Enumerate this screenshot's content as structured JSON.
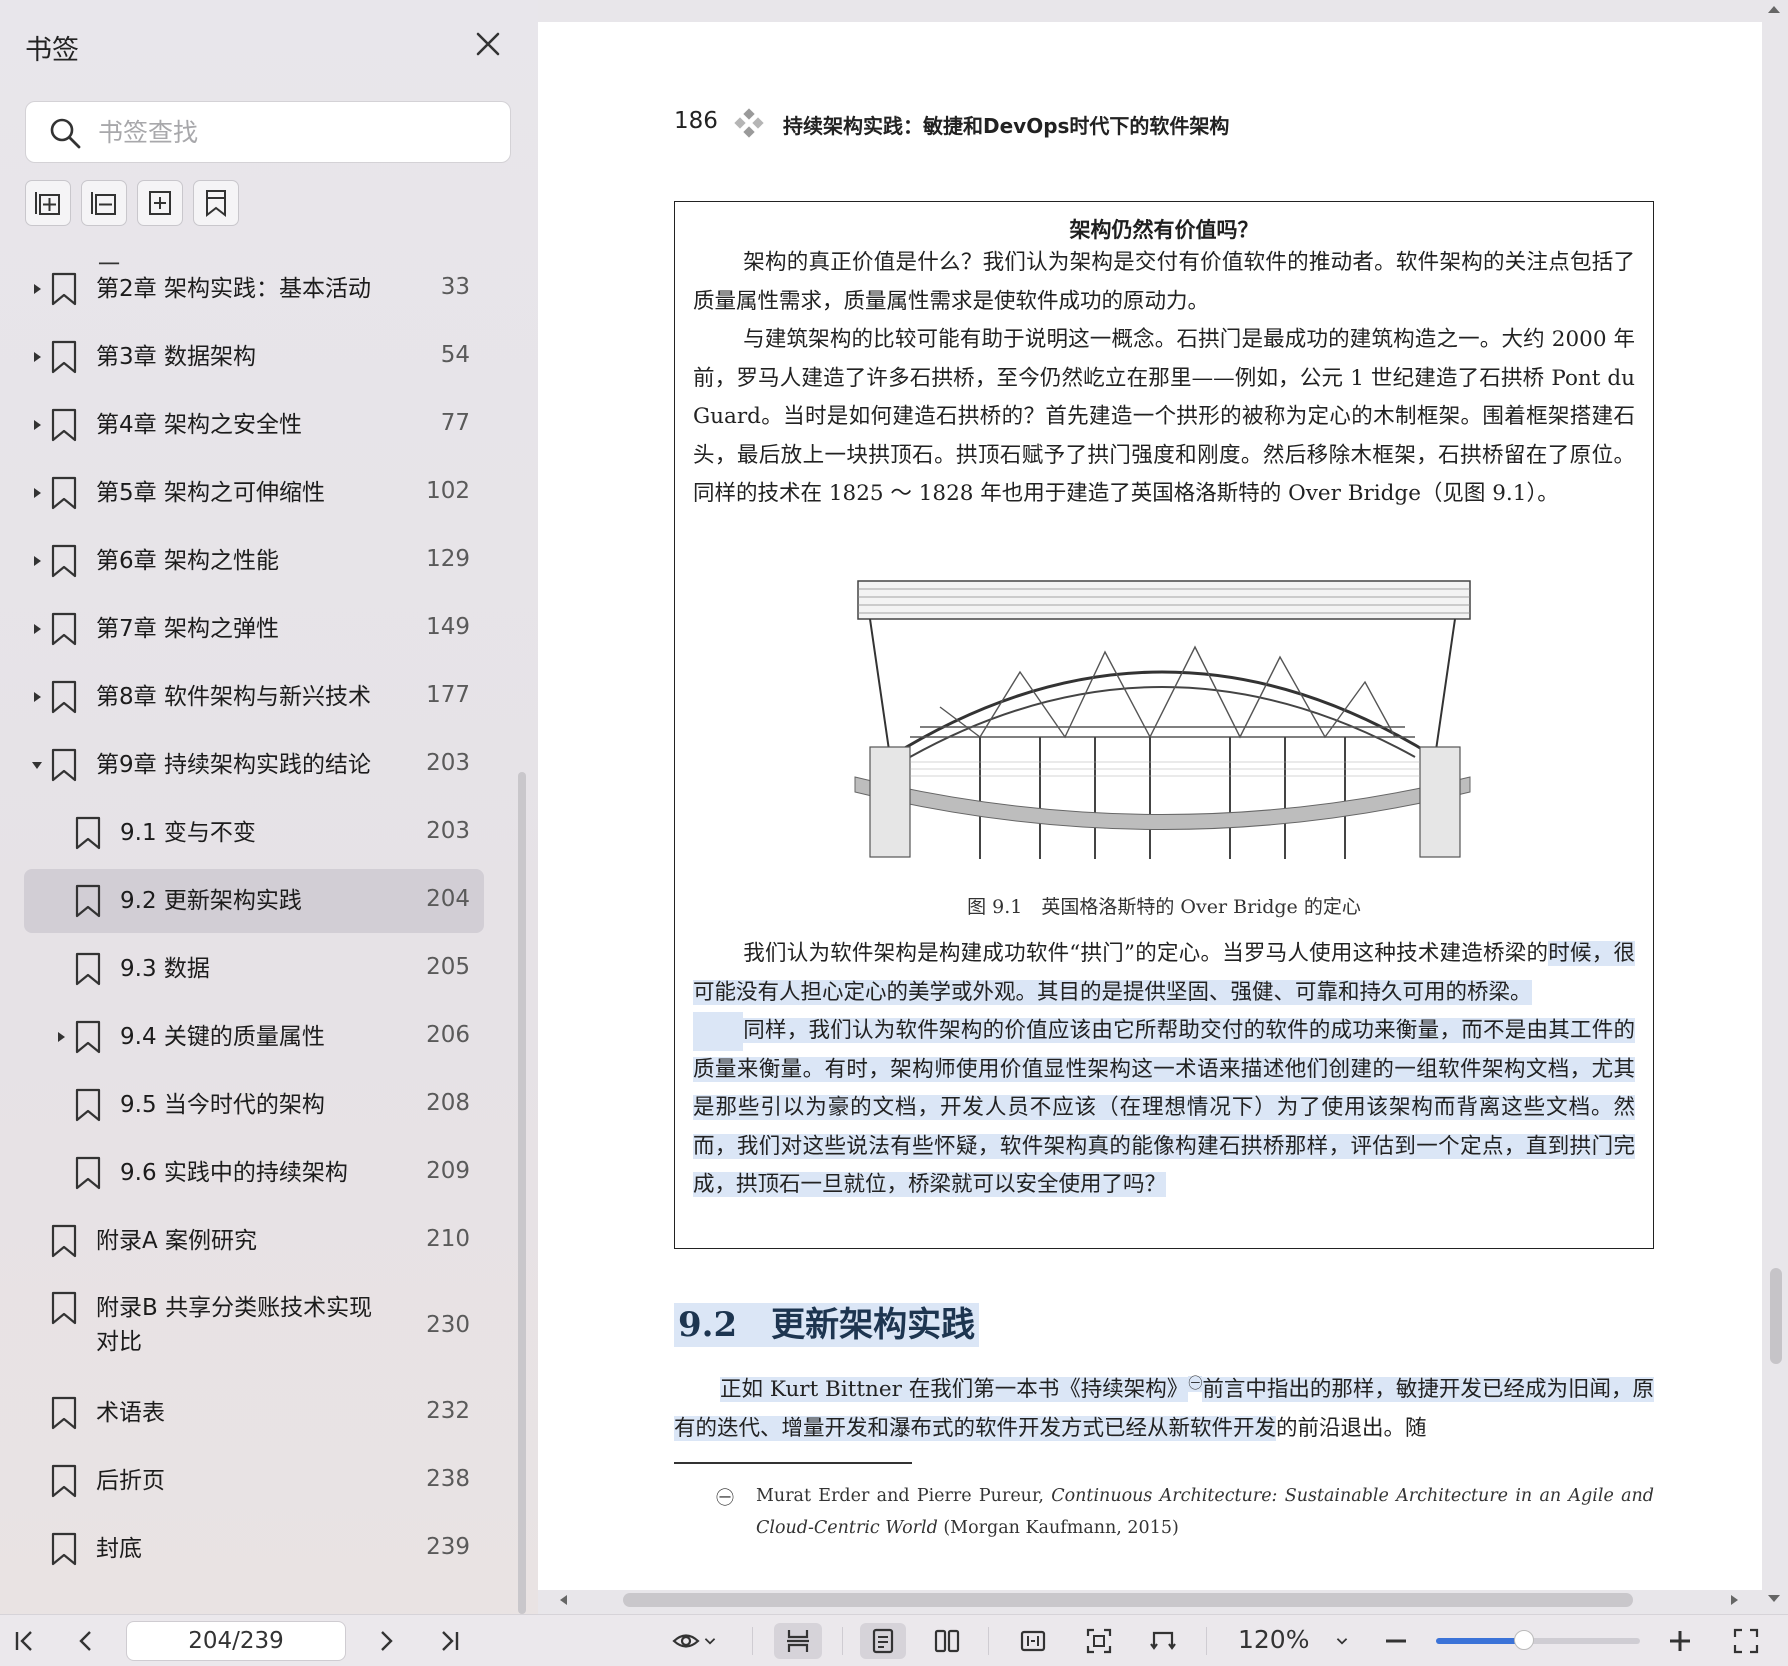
{
  "sidebar": {
    "title": "书签",
    "search_placeholder": "书签查找",
    "stray_mark": "一",
    "items": [
      {
        "label": "第2章 架构实践：基本活动",
        "page": "33",
        "level": 0,
        "caret": "right"
      },
      {
        "label": "第3章 数据架构",
        "page": "54",
        "level": 0,
        "caret": "right"
      },
      {
        "label": "第4章 架构之安全性",
        "page": "77",
        "level": 0,
        "caret": "right"
      },
      {
        "label": "第5章 架构之可伸缩性",
        "page": "102",
        "level": 0,
        "caret": "right"
      },
      {
        "label": "第6章 架构之性能",
        "page": "129",
        "level": 0,
        "caret": "right"
      },
      {
        "label": "第7章 架构之弹性",
        "page": "149",
        "level": 0,
        "caret": "right"
      },
      {
        "label": "第8章 软件架构与新兴技术",
        "page": "177",
        "level": 0,
        "caret": "right"
      },
      {
        "label": "第9章 持续架构实践的结论",
        "page": "203",
        "level": 0,
        "caret": "down"
      },
      {
        "label": "9.1 变与不变",
        "page": "203",
        "level": 1,
        "caret": ""
      },
      {
        "label": "9.2 更新架构实践",
        "page": "204",
        "level": 1,
        "caret": "",
        "selected": true
      },
      {
        "label": "9.3 数据",
        "page": "205",
        "level": 1,
        "caret": ""
      },
      {
        "label": "9.4 关键的质量属性",
        "page": "206",
        "level": 1,
        "caret": "right"
      },
      {
        "label": "9.5 当今时代的架构",
        "page": "208",
        "level": 1,
        "caret": ""
      },
      {
        "label": "9.6 实践中的持续架构",
        "page": "209",
        "level": 1,
        "caret": ""
      },
      {
        "label": "附录A 案例研究",
        "page": "210",
        "level": 0,
        "caret": ""
      },
      {
        "label": "附录B 共享分类账技术实现对比",
        "page": "230",
        "level": 0,
        "caret": "",
        "multiline": true
      },
      {
        "label": "术语表",
        "page": "232",
        "level": 0,
        "caret": ""
      },
      {
        "label": "后折页",
        "page": "238",
        "level": 0,
        "caret": ""
      },
      {
        "label": "封底",
        "page": "239",
        "level": 0,
        "caret": ""
      }
    ]
  },
  "page": {
    "number": "186",
    "header": "持续架构实践：敏捷和DevOps时代下的软件架构",
    "box_title": "架构仍然有价值吗？",
    "p1": "架构的真正价值是什么？我们认为架构是交付有价值软件的推动者。软件架构的关注点包括了质量属性需求，质量属性需求是使软件成功的原动力。",
    "p2": "与建筑架构的比较可能有助于说明这一概念。石拱门是最成功的建筑构造之一。大约 2000 年前，罗马人建造了许多石拱桥，至今仍然屹立在那里——例如，公元 1 世纪建造了石拱桥 Pont du Guard。当时是如何建造石拱桥的？首先建造一个拱形的被称为定心的木制框架。围着框架搭建石头，最后放上一块拱顶石。拱顶石赋予了拱门强度和刚度。然后移除木框架，石拱桥留在了原位。同样的技术在 1825 ～ 1828 年也用于建造了英国格洛斯特的 Over Bridge（见图 9.1）。",
    "fig_caption": "图 9.1　英国格洛斯特的 Over Bridge 的定心",
    "p3_a": "我们认为软件架构是构建成功软件“拱门”的定心。当罗马人使用这种技术建造桥梁的",
    "p3_b": "时候，很可能没有人担心定心的美学或外观。其目的是提供坚固、强健、可靠和持久可用的桥梁。",
    "p4": "同样，我们认为软件架构的价值应该由它所帮助交付的软件的成功来衡量，而不是由其工件的质量来衡量。有时，架构师使用价值显性架构这一术语来描述他们创建的一组软件架构文档，尤其是那些引以为豪的文档，开发人员不应该（在理想情况下）为了使用该架构而背离这些文档。然而，我们对这些说法有些怀疑，软件架构真的能像构建石拱桥那样，评估到一个定点，直到拱门完成，拱顶石一旦就位，桥梁就可以安全使用了吗？",
    "section_title": "9.2　更新架构实践",
    "sec_p_hl": "正如 Kurt Bittner 在我们第一本书《持续架构》",
    "sec_p_hl2": "前言中指出的那样，敏捷开发已经成为旧闻，原有的迭代、增量开发和瀑布式的软件开发方式已经从新软件开发",
    "sec_p_rest": "的前沿退出。随",
    "fn_marker": "㊀",
    "footnote_plain": "Murat Erder and Pierre Pureur, ",
    "footnote_italic": "Continuous Architecture: Sustainable Architecture in an Agile and Cloud-Centric World",
    "footnote_end": " (Morgan Kaufmann, 2015)"
  },
  "toolbar": {
    "page_indicator": "204/239",
    "zoom": "120%",
    "zoom_level": 0.43
  },
  "colors": {
    "highlight": "#dbe6f6",
    "section_title": "#1d3550",
    "accent": "#3b73d8"
  }
}
